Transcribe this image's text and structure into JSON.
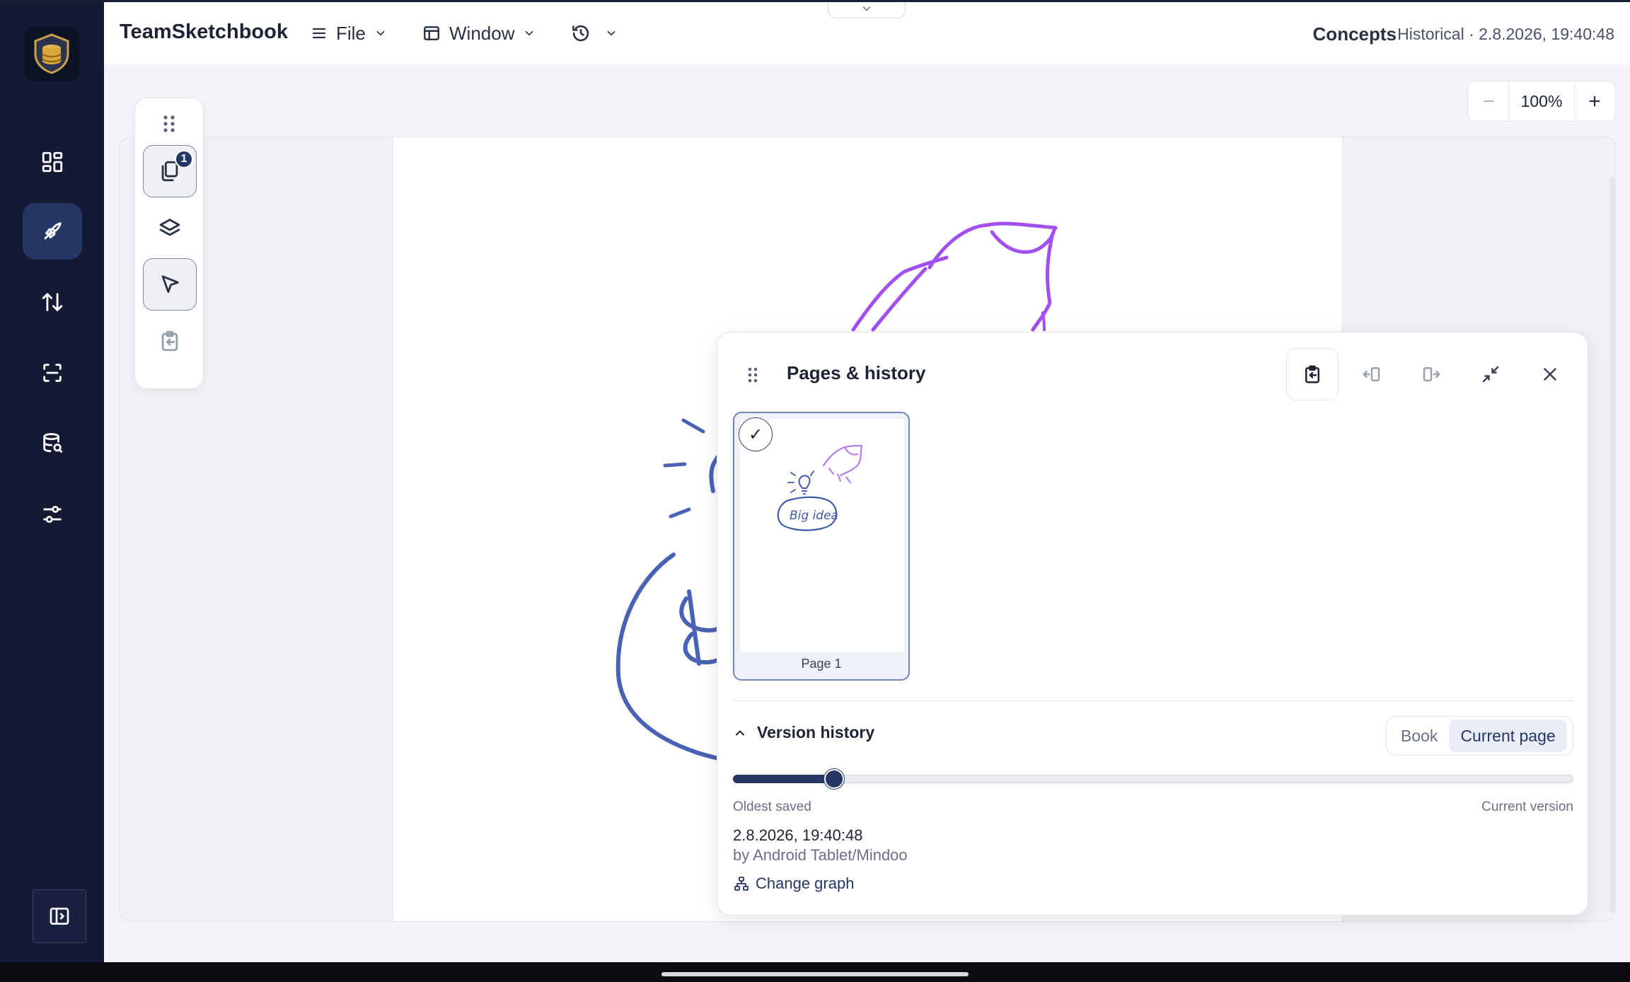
{
  "app": {
    "title": "TeamSketchbook",
    "document_name": "Concepts",
    "history_stamp": "Historical · 2.8.2026, 19:40:48"
  },
  "menus": {
    "file_label": "File",
    "window_label": "Window"
  },
  "zoom": {
    "value": "100%"
  },
  "palette": {
    "pages_badge": "1"
  },
  "panel": {
    "title": "Pages & history",
    "pages": [
      {
        "label": "Page 1",
        "selected": true,
        "check": "✓"
      }
    ],
    "version_history": {
      "title": "Version history",
      "scope_options": [
        "Book",
        "Current page"
      ],
      "active_scope": "Current page",
      "slider_position": 0.12,
      "oldest_label": "Oldest saved",
      "current_label": "Current version",
      "timestamp": "2.8.2026, 19:40:48",
      "author": "by Android Tablet/Mindoo",
      "change_graph_label": "Change graph"
    }
  },
  "colors": {
    "rail_bg": "#141a33",
    "accent": "#243663",
    "sketch_purple": "#a24ff0",
    "sketch_blue": "#4a62b4"
  }
}
